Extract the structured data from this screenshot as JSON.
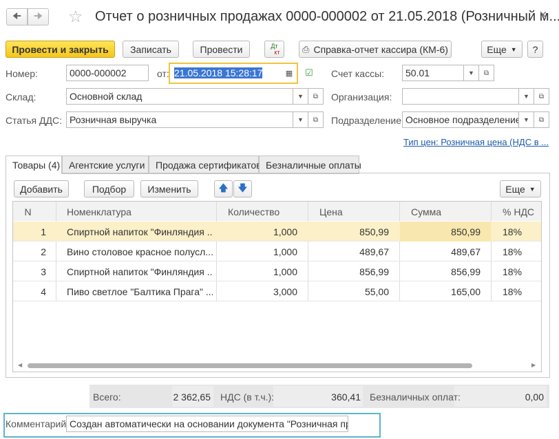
{
  "window": {
    "title": "Отчет о розничных продажах 0000-000002 от 21.05.2018 (Розничный м..."
  },
  "toolbar": {
    "post_close": "Провести и закрыть",
    "save": "Записать",
    "post": "Провести",
    "dtkt_top": "Дт",
    "dtkt_bottom": "кт",
    "report": "Справка-отчет кассира (КМ-6)",
    "more": "Еще",
    "help": "?"
  },
  "form": {
    "number_label": "Номер:",
    "number_value": "0000-000002",
    "date_label": "от:",
    "date_value": "21.05.2018 15:28:17",
    "cash_account_label": "Счет кассы:",
    "cash_account_value": "50.01",
    "warehouse_label": "Склад:",
    "warehouse_value": "Основной склад",
    "org_label": "Организация:",
    "org_value": "",
    "cash_flow_label": "Статья ДДС:",
    "cash_flow_value": "Розничная выручка",
    "division_label": "Подразделение:",
    "division_value": "Основное подразделение",
    "price_type_link": "Тип цен: Розничная цена (НДС в ..."
  },
  "tabs": [
    {
      "label": "Товары (4)"
    },
    {
      "label": "Агентские услуги"
    },
    {
      "label": "Продажа сертификатов"
    },
    {
      "label": "Безналичные оплаты"
    }
  ],
  "table_toolbar": {
    "add": "Добавить",
    "select": "Подбор",
    "change": "Изменить",
    "more": "Еще"
  },
  "table": {
    "columns": [
      "N",
      "Номенклатура",
      "Количество",
      "Цена",
      "Сумма",
      "% НДС"
    ],
    "rows": [
      {
        "n": "1",
        "name": "Спиртной напиток \"Финляндия ...",
        "qty": "1,000",
        "price": "850,99",
        "sum": "850,99",
        "vat": "18%"
      },
      {
        "n": "2",
        "name": "Вино столовое красное полусл...",
        "qty": "1,000",
        "price": "489,67",
        "sum": "489,67",
        "vat": "18%"
      },
      {
        "n": "3",
        "name": "Спиртной напиток \"Финляндия ...",
        "qty": "1,000",
        "price": "856,99",
        "sum": "856,99",
        "vat": "18%"
      },
      {
        "n": "4",
        "name": "Пиво светлое \"Балтика Прага\" ...",
        "qty": "3,000",
        "price": "55,00",
        "sum": "165,00",
        "vat": "18%"
      }
    ]
  },
  "totals": {
    "total_label": "Всего:",
    "total_value": "2 362,65",
    "vat_label": "НДС (в т.ч.):",
    "vat_value": "360,41",
    "cashless_label": "Безналичных оплат:",
    "cashless_value": "0,00"
  },
  "comment": {
    "label": "Комментарий:",
    "value": "Создан автоматически на основании документа \"Розничная прода"
  },
  "colors": {
    "accent_yellow": "#f5c61b",
    "selected_row": "#fbf0c8",
    "highlight_border_date": "#f0c53c",
    "highlight_border_comment": "#5ab4c8",
    "link": "#1c5bab"
  }
}
